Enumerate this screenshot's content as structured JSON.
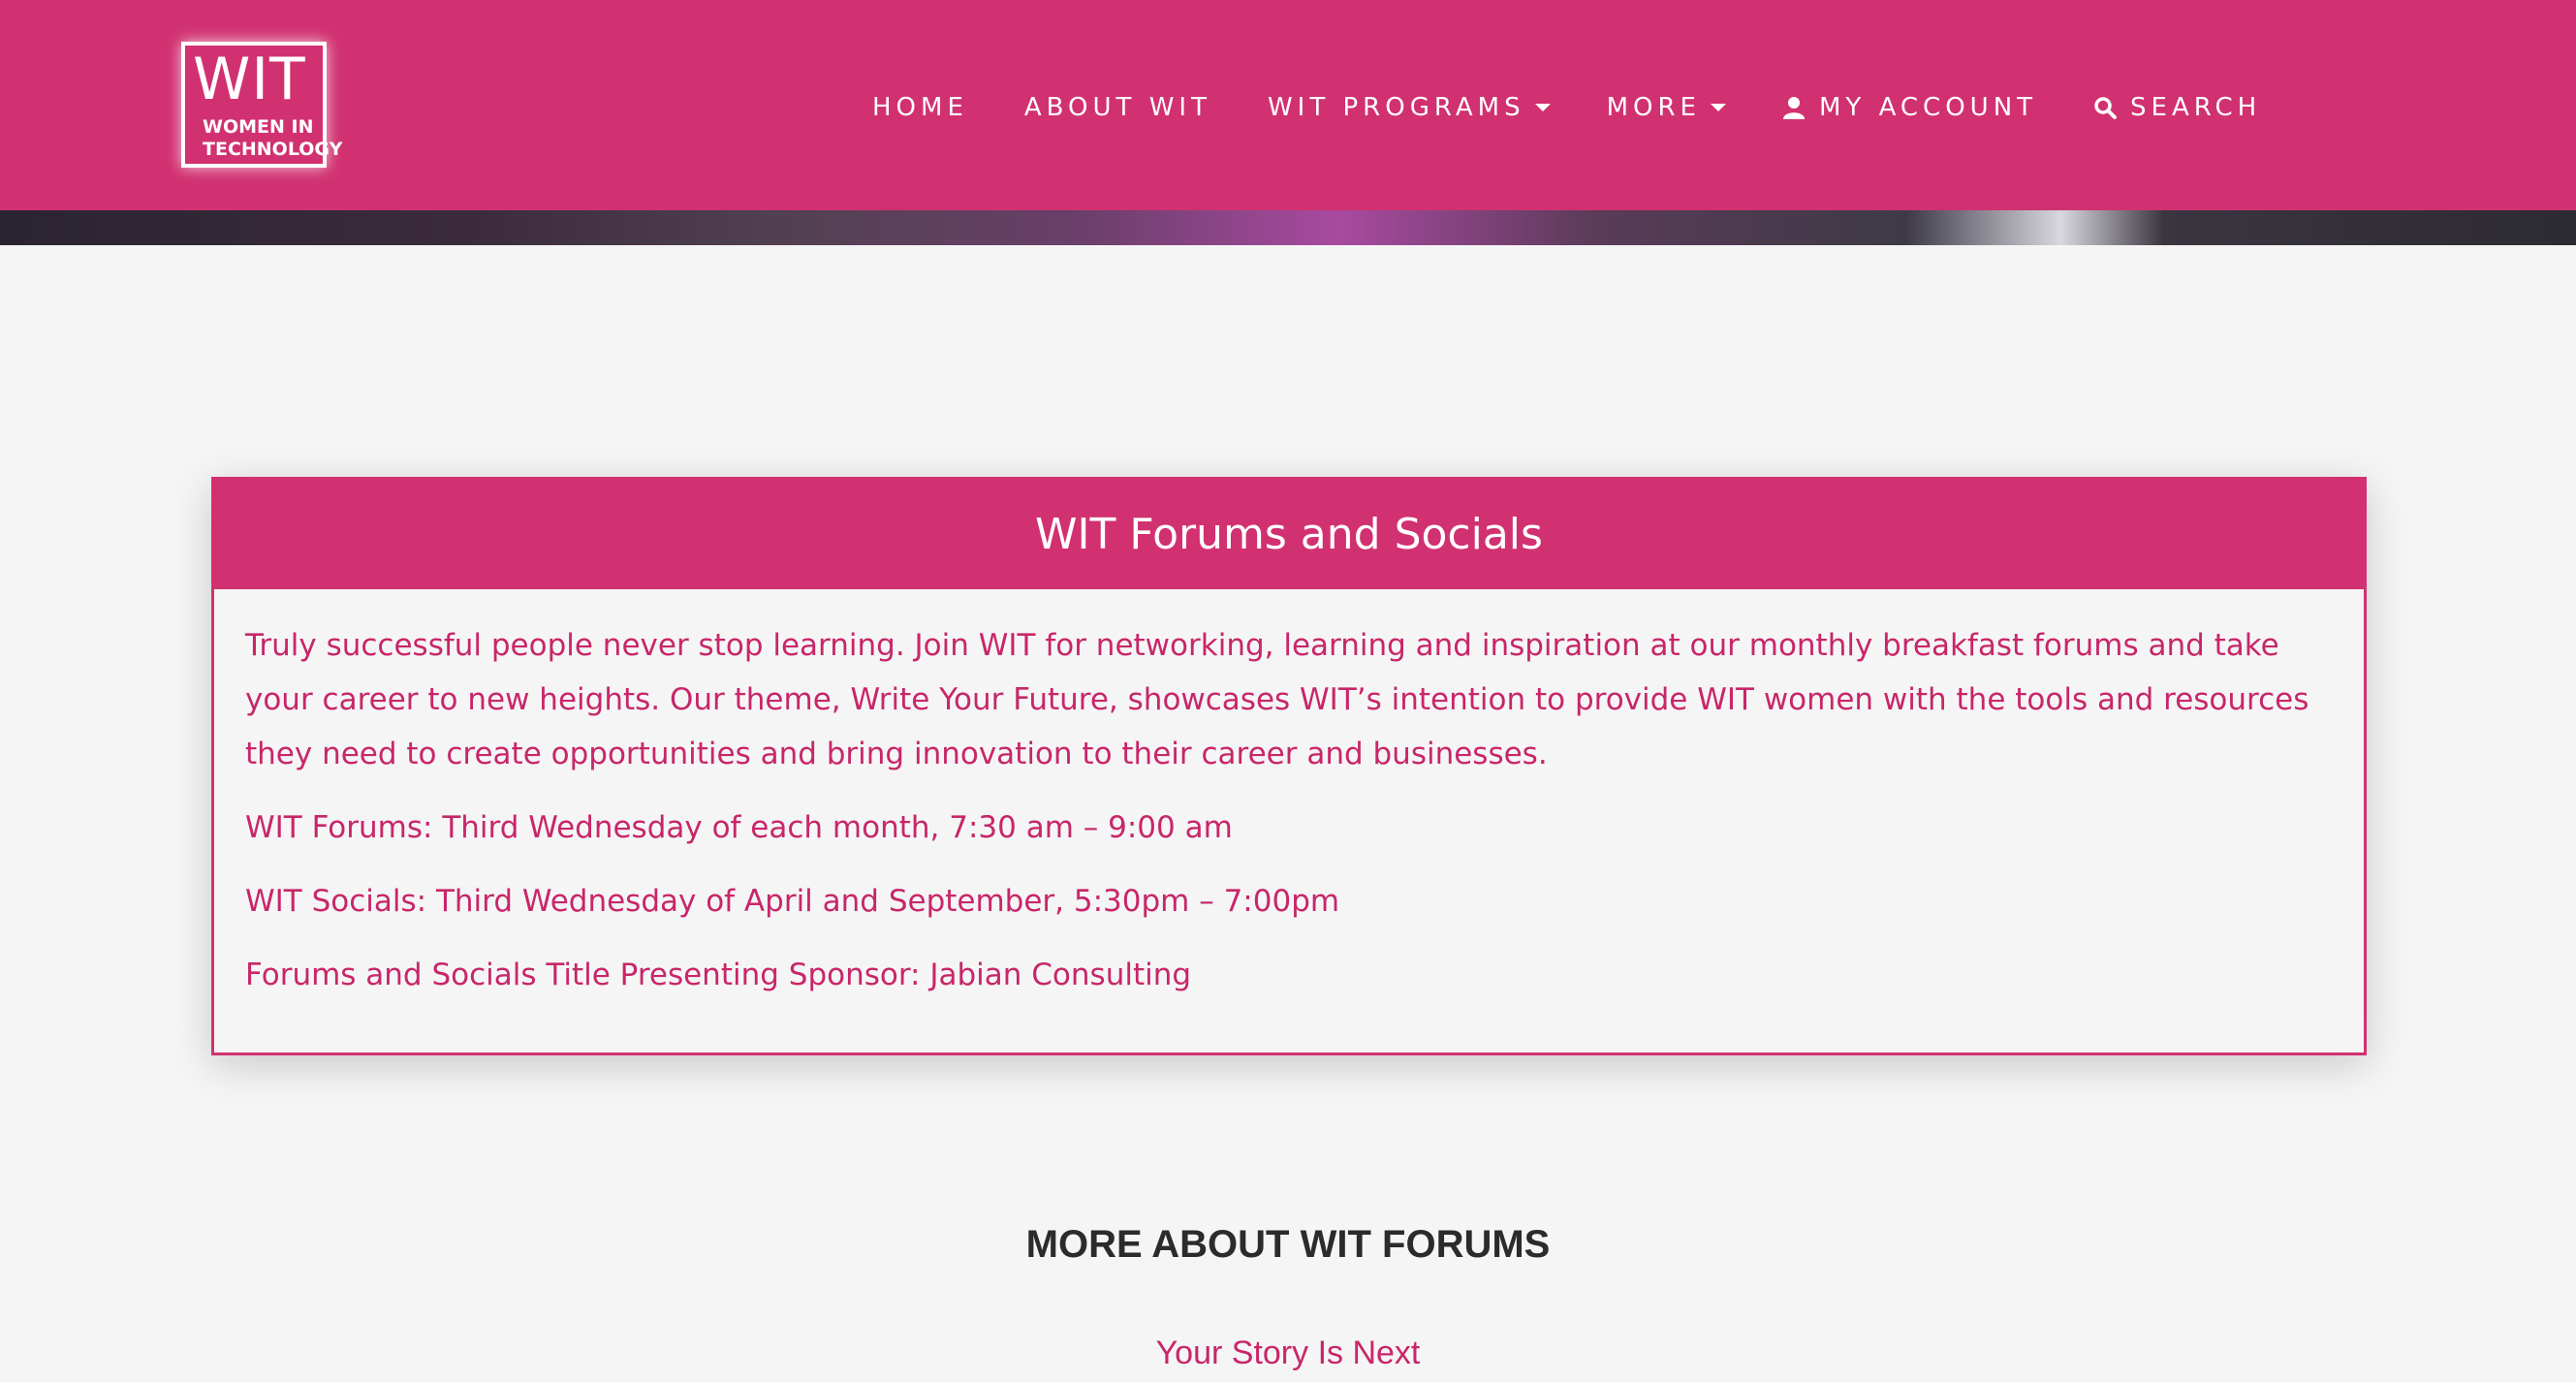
{
  "brand": {
    "logo_main": "WIT",
    "logo_line1": "WOMEN IN",
    "logo_line2": "TECHNOLOGY",
    "primary_color": "#d13170"
  },
  "nav": {
    "items": [
      {
        "label": "HOME",
        "icon": null,
        "dropdown": false
      },
      {
        "label": "ABOUT WIT",
        "icon": null,
        "dropdown": false
      },
      {
        "label": "WIT PROGRAMS",
        "icon": null,
        "dropdown": true
      },
      {
        "label": "MORE",
        "icon": null,
        "dropdown": true
      },
      {
        "label": "MY ACCOUNT",
        "icon": "user-icon",
        "dropdown": false
      },
      {
        "label": "SEARCH",
        "icon": "search-icon",
        "dropdown": false
      }
    ]
  },
  "card": {
    "title": "WIT Forums and Socials",
    "paragraphs": [
      "Truly successful people never stop learning. Join WIT for networking, learning and inspiration at our monthly breakfast forums and take your career to new heights. Our theme, Write Your Future, showcases WIT’s intention to provide WIT women with the tools and resources they need to create opportunities and bring innovation to their career and businesses.",
      "WIT Forums: Third Wednesday of each month, 7:30 am – 9:00 am",
      "WIT Socials: Third Wednesday of April and September, 5:30pm – 7:00pm",
      "Forums and Socials Title Presenting Sponsor: Jabian Consulting"
    ]
  },
  "section": {
    "title": "MORE ABOUT WIT FORUMS",
    "link": "Your Story Is Next"
  }
}
